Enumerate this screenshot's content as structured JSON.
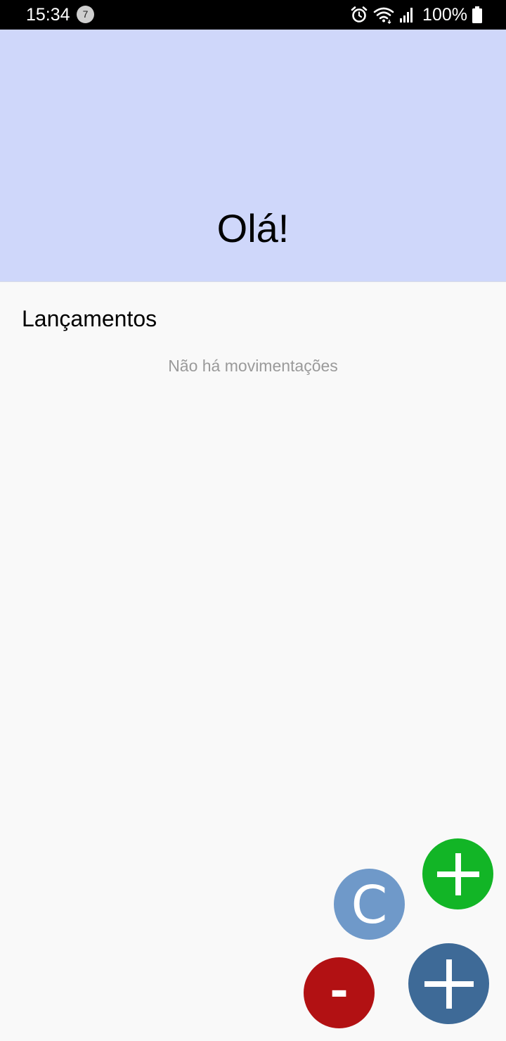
{
  "status_bar": {
    "time": "15:34",
    "notification_count": "7",
    "battery": "100%",
    "icons": [
      "alarm-icon",
      "wifi-icon",
      "signal-icon",
      "battery-icon"
    ]
  },
  "header": {
    "greeting": "Olá!"
  },
  "transactions": {
    "title": "Lançamentos",
    "empty_message": "Não há movimentações"
  },
  "fabs": {
    "income_icon": "plus-icon",
    "clear_label": "C",
    "expense_label": "-",
    "main_icon": "plus-icon"
  },
  "colors": {
    "header_bg": "#cfd7fa",
    "background": "#f9f9f9",
    "income_fab": "#12b526",
    "clear_fab": "#6f99c9",
    "expense_fab": "#b21113",
    "main_fab": "#3e6a97",
    "empty_text": "#9a9a9a"
  }
}
